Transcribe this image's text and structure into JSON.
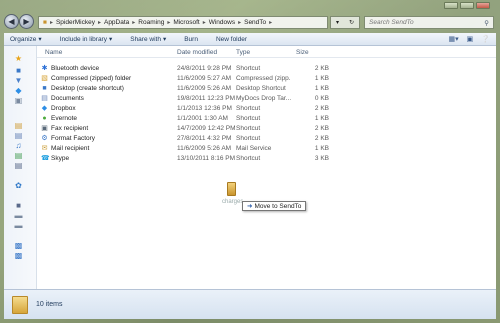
{
  "address": {
    "back_icon": "back-arrow-icon",
    "forward_icon": "forward-arrow-icon",
    "crumbs": [
      "SpiderMickey",
      "AppData",
      "Roaming",
      "Microsoft",
      "Windows",
      "SendTo"
    ],
    "search_placeholder": "Search SendTo"
  },
  "toolbar": {
    "organize": "Organize",
    "include_in_library": "Include in library",
    "share_with": "Share with",
    "burn": "Burn",
    "new_folder": "New folder"
  },
  "columns": {
    "name": "Name",
    "date": "Date modified",
    "type": "Type",
    "size": "Size"
  },
  "files": [
    {
      "name": "Bluetooth device",
      "date": "24/8/2011 9:28 PM",
      "type": "Shortcut",
      "size": "2 KB",
      "icon": "bluetooth-icon"
    },
    {
      "name": "Compressed (zipped) folder",
      "date": "11/6/2009 5:27 AM",
      "type": "Compressed (zipp...",
      "size": "1 KB",
      "icon": "zip-folder-icon"
    },
    {
      "name": "Desktop (create shortcut)",
      "date": "11/6/2009 5:26 AM",
      "type": "Desktop Shortcut",
      "size": "1 KB",
      "icon": "desktop-icon"
    },
    {
      "name": "Documents",
      "date": "19/8/2011 12:23 PM",
      "type": "MyDocs Drop Tar...",
      "size": "0 KB",
      "icon": "documents-icon"
    },
    {
      "name": "Dropbox",
      "date": "1/1/2013 12:36 PM",
      "type": "Shortcut",
      "size": "2 KB",
      "icon": "dropbox-icon"
    },
    {
      "name": "Evernote",
      "date": "1/1/2001 1:30 AM",
      "type": "Shortcut",
      "size": "1 KB",
      "icon": "evernote-icon"
    },
    {
      "name": "Fax recipient",
      "date": "14/7/2009 12:42 PM",
      "type": "Shortcut",
      "size": "2 KB",
      "icon": "fax-icon"
    },
    {
      "name": "Format Factory",
      "date": "27/8/2011 4:32 PM",
      "type": "Shortcut",
      "size": "2 KB",
      "icon": "format-factory-icon"
    },
    {
      "name": "Mail recipient",
      "date": "11/6/2009 5:26 AM",
      "type": "Mail Service",
      "size": "1 KB",
      "icon": "mail-icon"
    },
    {
      "name": "Skype",
      "date": "13/10/2011 8:16 PM",
      "type": "Shortcut",
      "size": "3 KB",
      "icon": "skype-icon"
    }
  ],
  "drag": {
    "label": "charges",
    "tooltip": "Move to SendTo"
  },
  "status": {
    "count": "10 items"
  }
}
